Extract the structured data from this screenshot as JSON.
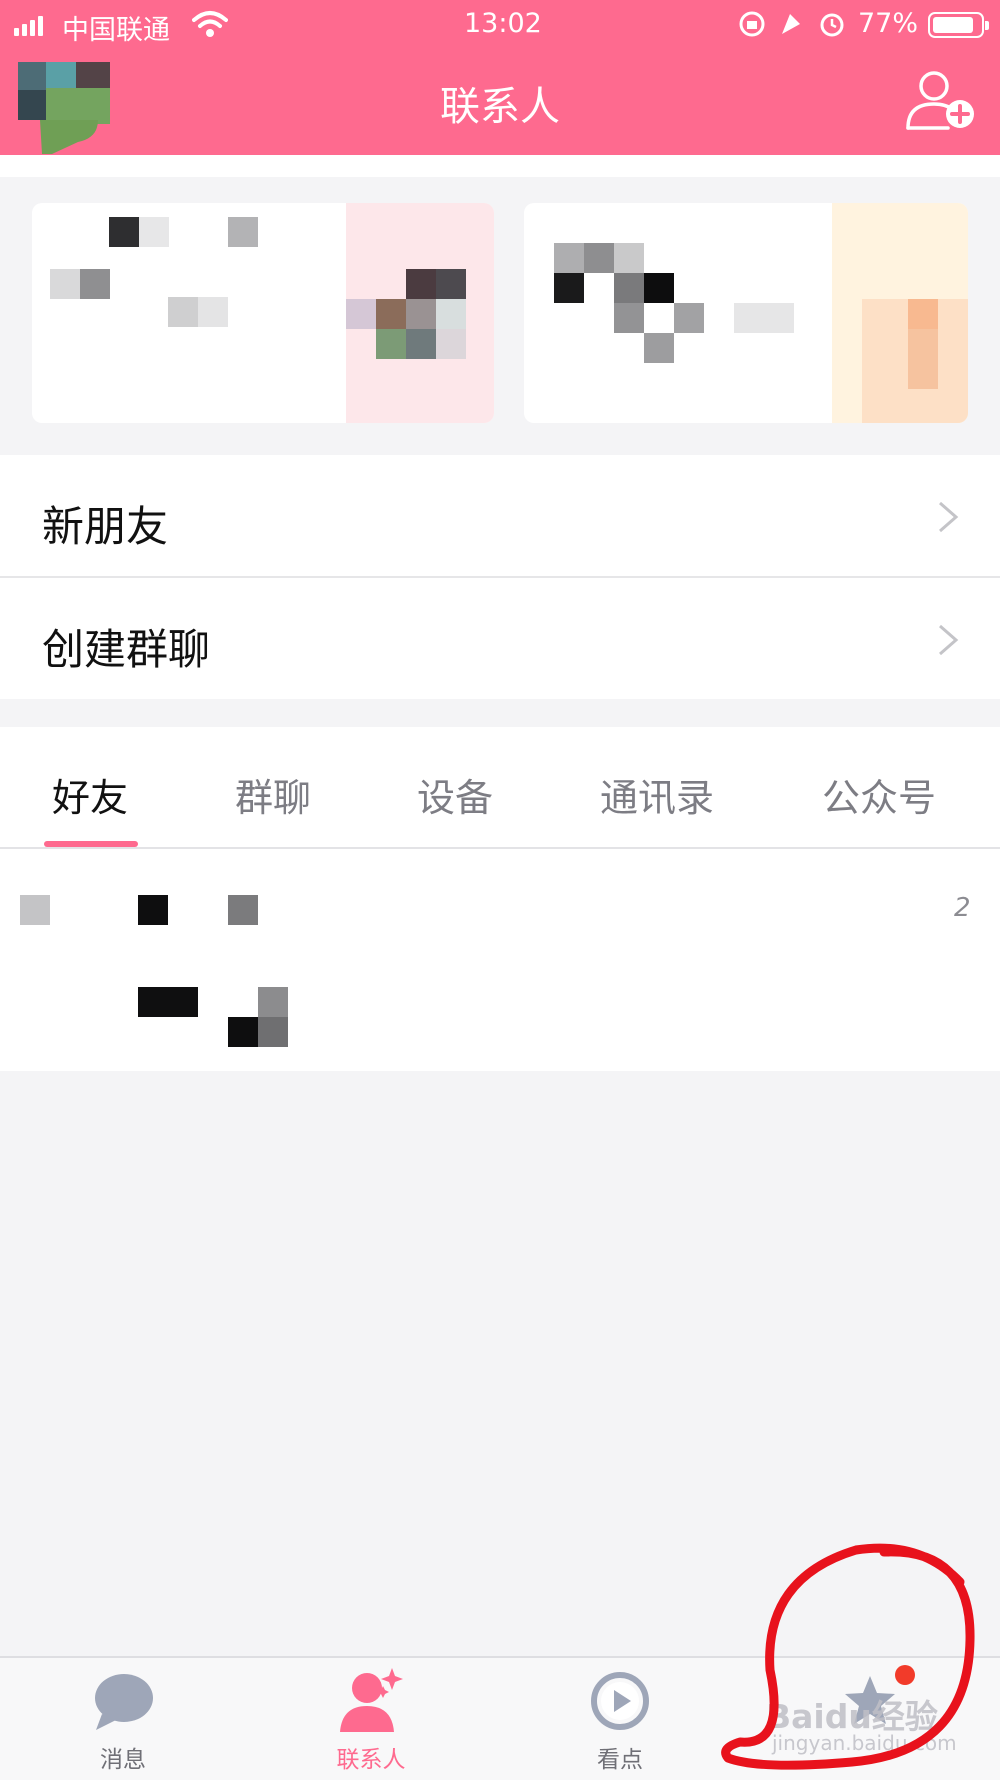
{
  "status_bar": {
    "carrier": "中国联通",
    "time": "13:02",
    "battery_percent": "77%",
    "battery_level": 0.77,
    "icons": [
      "signal-icon",
      "wifi-icon",
      "rotation-lock-icon",
      "location-icon",
      "alarm-icon",
      "battery-icon"
    ]
  },
  "header": {
    "title": "联系人",
    "right_icon": "add-contact-icon"
  },
  "menu": [
    {
      "label": "新朋友"
    },
    {
      "label": "创建群聊"
    }
  ],
  "tabs": [
    {
      "label": "好友",
      "active": true
    },
    {
      "label": "群聊",
      "active": false
    },
    {
      "label": "设备",
      "active": false
    },
    {
      "label": "通讯录",
      "active": false
    },
    {
      "label": "公众号",
      "active": false
    }
  ],
  "friends": {
    "count": "2"
  },
  "tabbar": [
    {
      "label": "消息",
      "icon": "message-bubble-icon",
      "active": false
    },
    {
      "label": "联系人",
      "icon": "contacts-person-icon",
      "active": true
    },
    {
      "label": "看点",
      "icon": "play-circle-icon",
      "active": false
    },
    {
      "label": "",
      "icon": "star-badge-icon",
      "active": false
    }
  ],
  "watermark": {
    "text": "Baidu经验",
    "sub": "jingyan.baidu.com"
  },
  "colors": {
    "brand_pink": "#fe6a8f",
    "badge_red": "#f23b2a",
    "annotation_red": "#e8121c"
  }
}
